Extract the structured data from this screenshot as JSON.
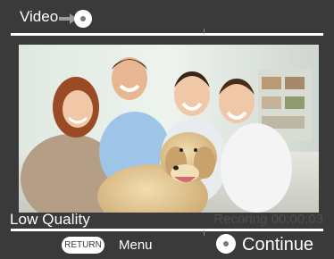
{
  "header": {
    "title": "Video",
    "icon": "arrow-right-ok-icon"
  },
  "video": {
    "description_icon": "video-preview"
  },
  "status": {
    "quality": "Low Quality",
    "recording": "Recoring 00:00:03"
  },
  "footer": {
    "return_label": "RETURN",
    "menu_label": "Menu",
    "continue_label": "Continue",
    "ok_icon": "ok-button-icon"
  },
  "colors": {
    "background": "#3a3a3a",
    "text": "#ffffff",
    "recording_text": "#505050"
  }
}
